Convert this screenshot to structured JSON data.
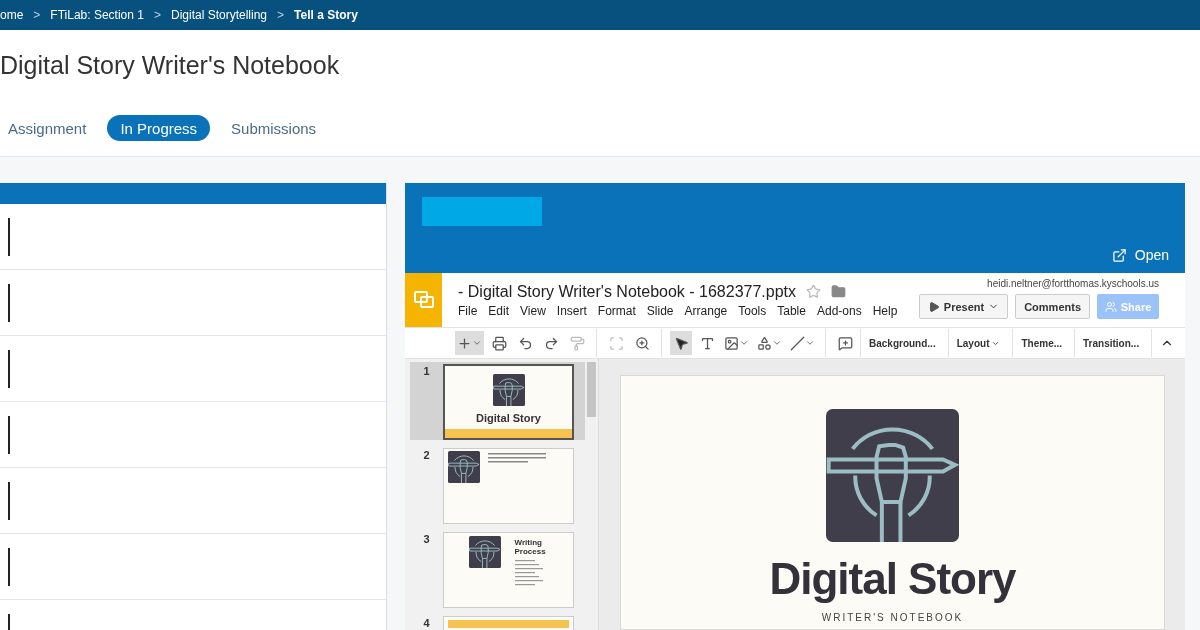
{
  "breadcrumb": [
    {
      "label": "ome",
      "current": false
    },
    {
      "label": "FTiLab: Section 1",
      "current": false
    },
    {
      "label": "Digital Storytelling",
      "current": false
    },
    {
      "label": "Tell a Story",
      "current": true
    }
  ],
  "breadcrumb_separator": ">",
  "page_title": "Digital Story Writer's Notebook",
  "tabs": [
    {
      "label": "Assignment",
      "selected": false
    },
    {
      "label": "In Progress",
      "selected": true
    },
    {
      "label": "Submissions",
      "selected": false
    }
  ],
  "preview": {
    "open_label": "Open",
    "slides_app": {
      "doc_title": "- Digital Story Writer's Notebook - 1682377.pptx",
      "account": "heidi.neltner@fortthomas.kyschools.us",
      "menu": [
        "File",
        "Edit",
        "View",
        "Insert",
        "Format",
        "Slide",
        "Arrange",
        "Tools",
        "Table",
        "Add-ons",
        "Help"
      ],
      "present_label": "Present",
      "comments_label": "Comments",
      "share": {
        "label": "Share",
        "disabled": true
      },
      "toolbar_buttons": [
        {
          "label": "Background...",
          "dropdown": false
        },
        {
          "label": "Layout",
          "dropdown": true
        },
        {
          "label": "Theme...",
          "dropdown": false
        },
        {
          "label": "Transition...",
          "dropdown": false
        }
      ],
      "slides": [
        {
          "number": "1",
          "selected": true,
          "kind": "title",
          "title": "Digital Story"
        },
        {
          "number": "2",
          "selected": false,
          "kind": "text"
        },
        {
          "number": "3",
          "selected": false,
          "kind": "list",
          "title": "Writing Process"
        },
        {
          "number": "4",
          "selected": false,
          "kind": "banner"
        }
      ],
      "current_slide": {
        "title": "Digital Story",
        "subtitle": "WRITER'S NOTEBOOK"
      }
    }
  }
}
